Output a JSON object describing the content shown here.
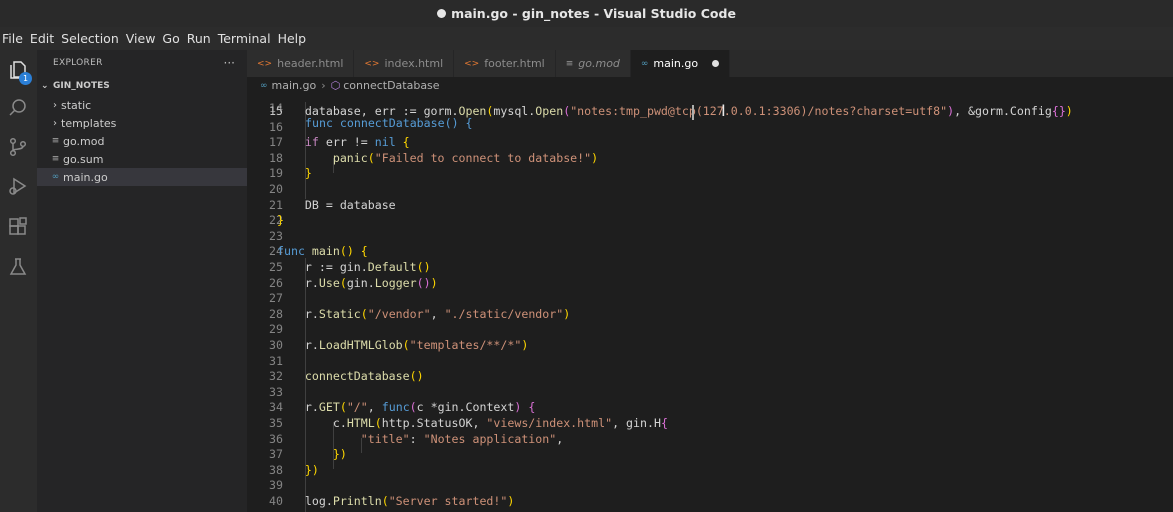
{
  "window": {
    "title": "main.go - gin_notes - Visual Studio Code"
  },
  "menu": [
    "File",
    "Edit",
    "Selection",
    "View",
    "Go",
    "Run",
    "Terminal",
    "Help"
  ],
  "activity_bar": {
    "badge_count": "1",
    "icons": [
      "explorer-icon",
      "search-icon",
      "source-control-icon",
      "run-debug-icon",
      "extensions-icon",
      "testing-icon"
    ]
  },
  "sidebar": {
    "title": "EXPLORER",
    "more": "···",
    "root": "GIN_NOTES",
    "items": [
      {
        "label": "static",
        "type": "folder"
      },
      {
        "label": "templates",
        "type": "folder"
      },
      {
        "label": "go.mod",
        "type": "mod"
      },
      {
        "label": "go.sum",
        "type": "mod"
      },
      {
        "label": "main.go",
        "type": "go",
        "selected": true
      }
    ]
  },
  "tabs": [
    {
      "label": "header.html",
      "icon": "html-icon"
    },
    {
      "label": "index.html",
      "icon": "html-icon"
    },
    {
      "label": "footer.html",
      "icon": "html-icon"
    },
    {
      "label": "go.mod",
      "icon": "mod-icon",
      "italic": true
    },
    {
      "label": "main.go",
      "icon": "go-icon",
      "active": true,
      "modified": true
    }
  ],
  "breadcrumb": {
    "file": "main.go",
    "symbol": "connectDatabase"
  },
  "editor": {
    "top_partial_line": "func connectDatabase() {",
    "top_partial_number": "14",
    "current_line": "15",
    "lines": [
      {
        "n": "15",
        "text": "    database, err := gorm.Open(mysql.Open(\"notes:tmp_pwd@tcp(127.0.0.1:3306)/notes?charset=utf8\"), &gorm.Config{})"
      },
      {
        "n": "16",
        "text": ""
      },
      {
        "n": "17",
        "text": "    if err != nil {"
      },
      {
        "n": "18",
        "text": "        panic(\"Failed to connect to databse!\")"
      },
      {
        "n": "19",
        "text": "    }"
      },
      {
        "n": "20",
        "text": ""
      },
      {
        "n": "21",
        "text": "    DB = database"
      },
      {
        "n": "22",
        "text": "}"
      },
      {
        "n": "23",
        "text": ""
      },
      {
        "n": "24",
        "text": "func main() {"
      },
      {
        "n": "25",
        "text": "    r := gin.Default()"
      },
      {
        "n": "26",
        "text": "    r.Use(gin.Logger())"
      },
      {
        "n": "27",
        "text": ""
      },
      {
        "n": "28",
        "text": "    r.Static(\"/vendor\", \"./static/vendor\")"
      },
      {
        "n": "29",
        "text": ""
      },
      {
        "n": "30",
        "text": "    r.LoadHTMLGlob(\"templates/**/*\")"
      },
      {
        "n": "31",
        "text": ""
      },
      {
        "n": "32",
        "text": "    connectDatabase()"
      },
      {
        "n": "33",
        "text": ""
      },
      {
        "n": "34",
        "text": "    r.GET(\"/\", func(c *gin.Context) {"
      },
      {
        "n": "35",
        "text": "        c.HTML(http.StatusOK, \"views/index.html\", gin.H{"
      },
      {
        "n": "36",
        "text": "            \"title\": \"Notes application\","
      },
      {
        "n": "37",
        "text": "        })"
      },
      {
        "n": "38",
        "text": "    })"
      },
      {
        "n": "39",
        "text": ""
      },
      {
        "n": "40",
        "text": "    log.Println(\"Server started!\")"
      }
    ]
  },
  "colors": {
    "accent": "#2b7fd6",
    "keyword": "#569cd6",
    "string": "#ce9178",
    "function": "#dcdcaa",
    "control": "#c586c0"
  }
}
